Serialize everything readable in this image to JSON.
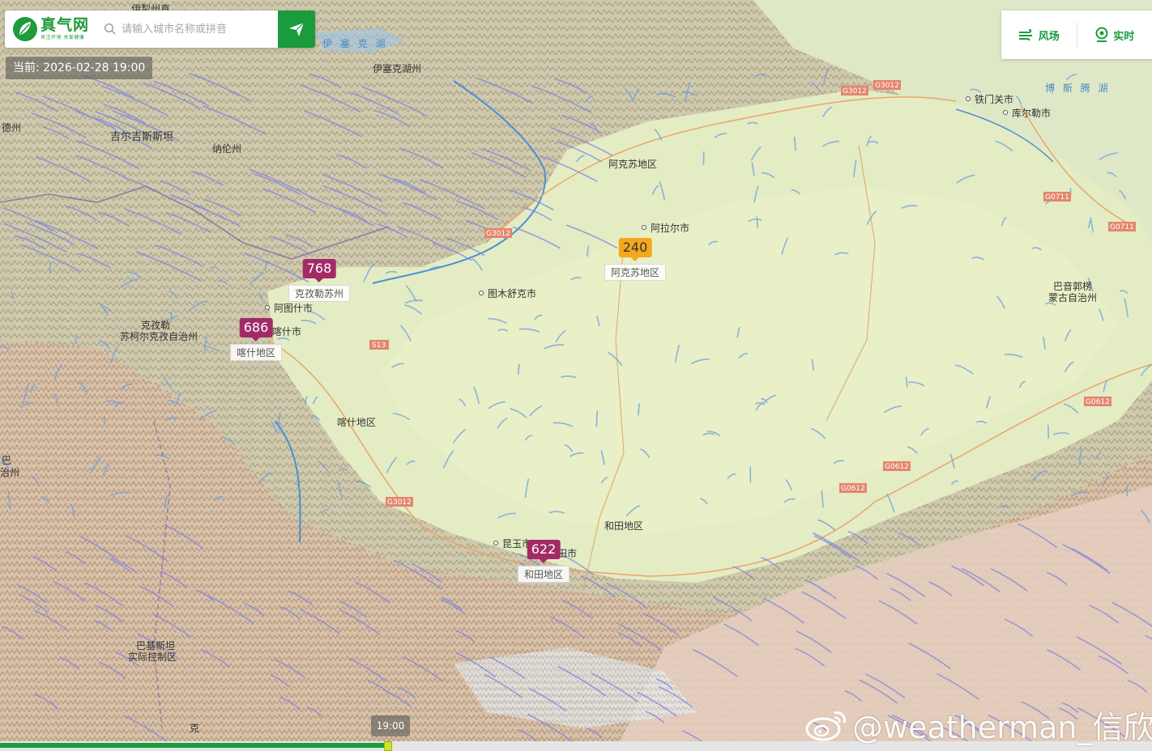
{
  "search": {
    "brand_name": "真气网",
    "brand_slogan": "关注环境  关爱健康",
    "placeholder": "请输入城市名称或拼音"
  },
  "current_time": "当前: 2026-02-28 19:00",
  "controls": {
    "wind_label": "风场",
    "realtime_label": "实时"
  },
  "markers": [
    {
      "value": "768",
      "label": "克孜勒苏州",
      "level": "purple"
    },
    {
      "value": "686",
      "label": "喀什地区",
      "level": "purple"
    },
    {
      "value": "240",
      "label": "阿克苏地区",
      "level": "orange"
    },
    {
      "value": "622",
      "label": "和田地区",
      "level": "purple"
    }
  ],
  "map_labels": {
    "yili": "伊犁州直",
    "yisai_lake": "伊 塞 克 湖",
    "yisai_state": "伊塞克湖州",
    "kyrgyz": "吉尔吉斯斯坦",
    "naren": "纳伦州",
    "dezhou": "德州",
    "aksu_region": "阿克苏地区",
    "alar": "阿拉尔市",
    "tumxuk": "图木舒克市",
    "artux": "阿图什市",
    "kashgar_city": "喀什市",
    "kashgar_region": "喀什地区",
    "kizilsu_1": "克孜勒",
    "kizilsu_2": "苏柯尔克孜自治州",
    "tiemenguan": "铁门关市",
    "korla": "库尔勒市",
    "bosten": "博 斯 腾 湖",
    "bayin_1": "巴音郭楞",
    "bayin_2": "蒙古自治州",
    "hotan_region": "和田地区",
    "kunyu": "昆玉市",
    "hotan_city": "和田市",
    "pak_1": "巴基斯坦",
    "pak_2": "实际控制区",
    "zhizhou_1": "巴",
    "zhizhou_2": "治州",
    "ke": "克"
  },
  "roads": [
    "G3012",
    "G3012",
    "G3012",
    "S13",
    "G3012",
    "G0711",
    "G0711",
    "G0612",
    "G0612",
    "G0612"
  ],
  "timeline": {
    "tooltip": "19:00",
    "progress": 0.336
  },
  "watermark": "@weatherman_信欣"
}
